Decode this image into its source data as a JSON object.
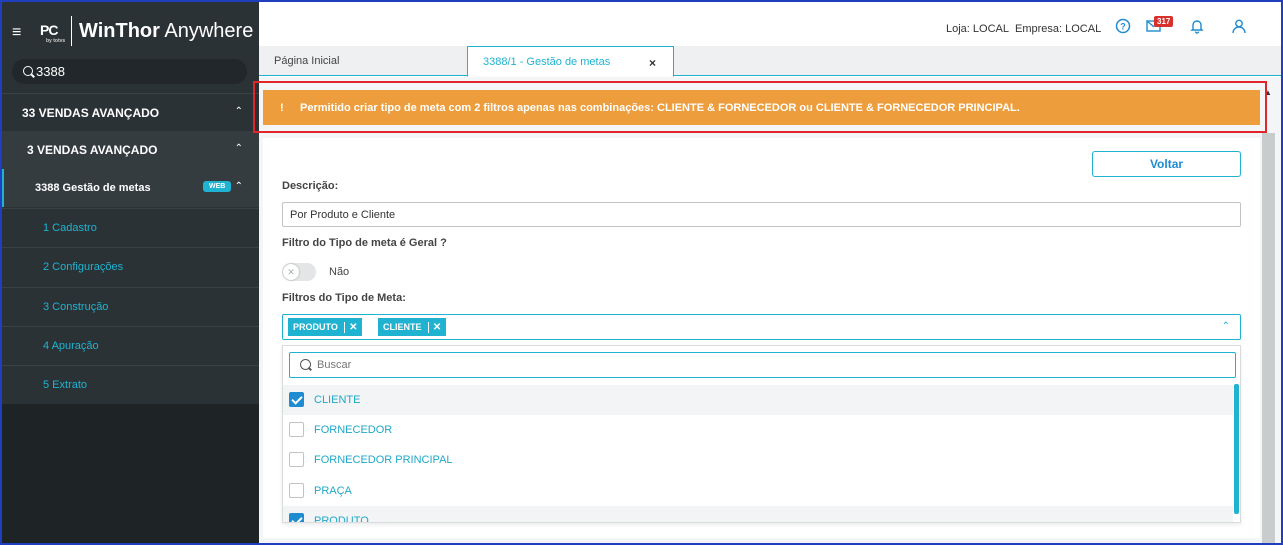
{
  "app": {
    "brand_bold": "WinThor",
    "brand_light": "Anywhere",
    "logo_text": "PC",
    "logo_sub": "by totvs"
  },
  "sidebar": {
    "search_value": "3388",
    "items": [
      {
        "label": "33  VENDAS AVANÇADO"
      },
      {
        "label": "3  VENDAS AVANÇADO"
      },
      {
        "label": "3388   Gestão de metas",
        "badge": "WEB"
      }
    ],
    "subitems": [
      {
        "label": "1  Cadastro"
      },
      {
        "label": "2  Configurações"
      },
      {
        "label": "3  Construção"
      },
      {
        "label": "4  Apuração"
      },
      {
        "label": "5  Extrato"
      }
    ]
  },
  "header": {
    "loja": "Loja: LOCAL",
    "empresa": "Empresa: LOCAL",
    "mail_count": "317"
  },
  "tabs": [
    {
      "label": "Página Inicial"
    },
    {
      "label": "3388/1 - Gestão de metas",
      "close": "×"
    }
  ],
  "alert": {
    "icon": "!",
    "message": "Permitido criar tipo de meta com 2 filtros apenas nas combinações: CLIENTE & FORNECEDOR ou CLIENTE & FORNECEDOR PRINCIPAL."
  },
  "form": {
    "back_button": "Voltar",
    "descricao_label": "Descrição:",
    "descricao_value": "Por Produto e Cliente",
    "filtro_geral_label": "Filtro do Tipo de meta é Geral ?",
    "toggle_label": "Não",
    "filtros_label": "Filtros do Tipo de Meta:",
    "chips": [
      "PRODUTO",
      "CLIENTE"
    ],
    "search_placeholder": "Buscar",
    "options": [
      {
        "label": "CLIENTE",
        "checked": true
      },
      {
        "label": "FORNECEDOR",
        "checked": false
      },
      {
        "label": "FORNECEDOR PRINCIPAL",
        "checked": false
      },
      {
        "label": "PRAÇA",
        "checked": false
      },
      {
        "label": "PRODUTO",
        "checked": true
      }
    ]
  },
  "colors": {
    "accent": "#1fb3d1",
    "alert": "#ee9d3c",
    "sidebar": "#2b3235",
    "highlight_outline": "#e0262b"
  }
}
